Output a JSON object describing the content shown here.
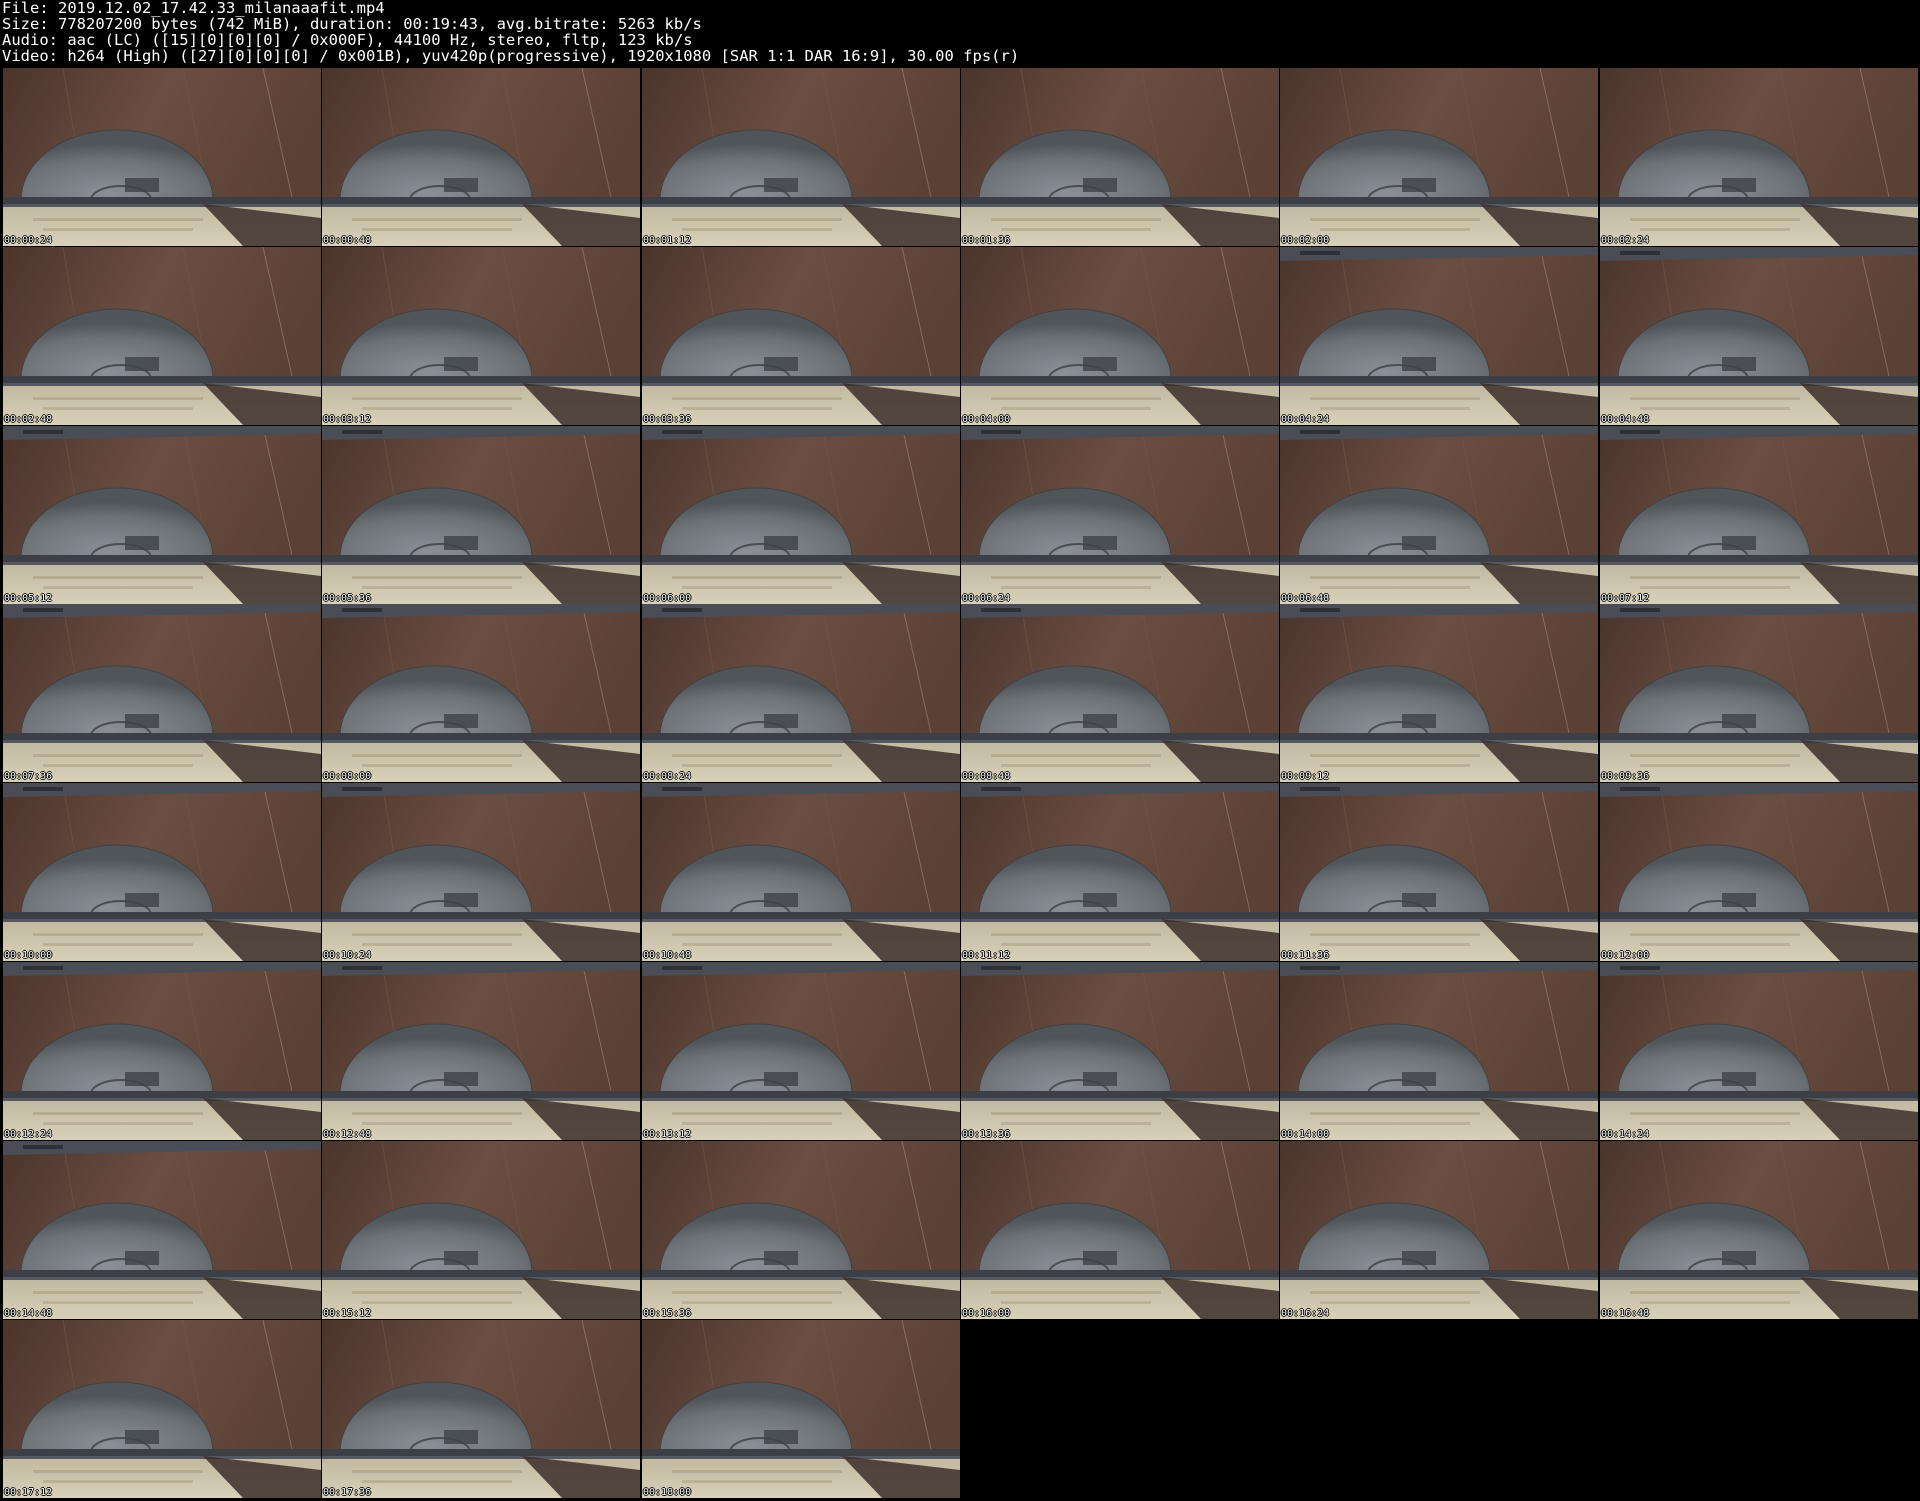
{
  "header": {
    "file_line": "File: 2019.12.02_17.42.33_milanaaafit.mp4",
    "size_line": "Size: 778207200 bytes (742 MiB), duration: 00:19:43, avg.bitrate: 5263 kb/s",
    "audio_line": "Audio: aac (LC) ([15][0][0][0] / 0x000F), 44100 Hz, stereo, fltp, 123 kb/s",
    "video_line": "Video: h264 (High) ([27][0][0][0] / 0x001B), yuv420p(progressive), 1920x1080 [SAR 1:1 DAR 16:9], 30.00 fps(r)"
  },
  "grid": {
    "columns": 6,
    "thumbnails": [
      {
        "timestamp": "00:00:24",
        "bar_visible": false
      },
      {
        "timestamp": "00:00:48",
        "bar_visible": false
      },
      {
        "timestamp": "00:01:12",
        "bar_visible": false
      },
      {
        "timestamp": "00:01:36",
        "bar_visible": false
      },
      {
        "timestamp": "00:02:00",
        "bar_visible": false
      },
      {
        "timestamp": "00:02:24",
        "bar_visible": false
      },
      {
        "timestamp": "00:02:48",
        "bar_visible": false
      },
      {
        "timestamp": "00:03:12",
        "bar_visible": false
      },
      {
        "timestamp": "00:03:36",
        "bar_visible": false
      },
      {
        "timestamp": "00:04:00",
        "bar_visible": false
      },
      {
        "timestamp": "00:04:24",
        "bar_visible": true
      },
      {
        "timestamp": "00:04:48",
        "bar_visible": true
      },
      {
        "timestamp": "00:05:12",
        "bar_visible": true
      },
      {
        "timestamp": "00:05:36",
        "bar_visible": true
      },
      {
        "timestamp": "00:06:00",
        "bar_visible": true
      },
      {
        "timestamp": "00:06:24",
        "bar_visible": true
      },
      {
        "timestamp": "00:06:48",
        "bar_visible": true
      },
      {
        "timestamp": "00:07:12",
        "bar_visible": true
      },
      {
        "timestamp": "00:07:36",
        "bar_visible": true
      },
      {
        "timestamp": "00:08:00",
        "bar_visible": true
      },
      {
        "timestamp": "00:08:24",
        "bar_visible": true
      },
      {
        "timestamp": "00:08:48",
        "bar_visible": true
      },
      {
        "timestamp": "00:09:12",
        "bar_visible": true
      },
      {
        "timestamp": "00:09:36",
        "bar_visible": true
      },
      {
        "timestamp": "00:10:00",
        "bar_visible": true
      },
      {
        "timestamp": "00:10:24",
        "bar_visible": true
      },
      {
        "timestamp": "00:10:48",
        "bar_visible": true
      },
      {
        "timestamp": "00:11:12",
        "bar_visible": true
      },
      {
        "timestamp": "00:11:36",
        "bar_visible": true
      },
      {
        "timestamp": "00:12:00",
        "bar_visible": true
      },
      {
        "timestamp": "00:12:24",
        "bar_visible": true
      },
      {
        "timestamp": "00:12:48",
        "bar_visible": true
      },
      {
        "timestamp": "00:13:12",
        "bar_visible": true
      },
      {
        "timestamp": "00:13:36",
        "bar_visible": true
      },
      {
        "timestamp": "00:14:00",
        "bar_visible": true
      },
      {
        "timestamp": "00:14:24",
        "bar_visible": true
      },
      {
        "timestamp": "00:14:48",
        "bar_visible": true
      },
      {
        "timestamp": "00:15:12",
        "bar_visible": false
      },
      {
        "timestamp": "00:15:36",
        "bar_visible": false
      },
      {
        "timestamp": "00:16:00",
        "bar_visible": false
      },
      {
        "timestamp": "00:16:24",
        "bar_visible": false
      },
      {
        "timestamp": "00:16:48",
        "bar_visible": false
      },
      {
        "timestamp": "00:17:12",
        "bar_visible": false
      },
      {
        "timestamp": "00:17:36",
        "bar_visible": false
      },
      {
        "timestamp": "00:18:00",
        "bar_visible": false
      }
    ]
  },
  "colors": {
    "background": "#000000",
    "header_text": "#ffffff",
    "wood_dark": "#4a342b",
    "wood_mid": "#6b4e42",
    "disc": "#6c7176",
    "keyboard": "#d8d0b8",
    "bar": "#4a4d55"
  }
}
